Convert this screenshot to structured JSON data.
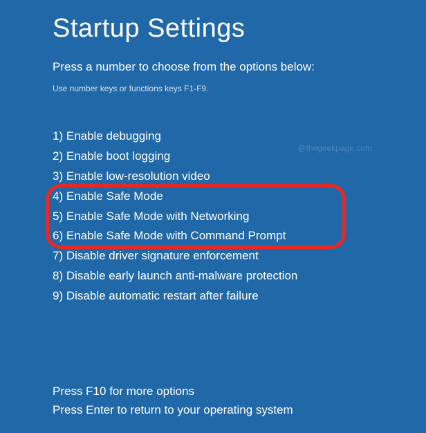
{
  "title": "Startup Settings",
  "instruction": "Press a number to choose from the options below:",
  "hint": "Use number keys or functions keys F1-F9.",
  "watermark": "@thegeekpage.com",
  "options": [
    {
      "num": "1",
      "label": "Enable debugging"
    },
    {
      "num": "2",
      "label": "Enable boot logging"
    },
    {
      "num": "3",
      "label": "Enable low-resolution video"
    },
    {
      "num": "4",
      "label": "Enable Safe Mode"
    },
    {
      "num": "5",
      "label": "Enable Safe Mode with Networking"
    },
    {
      "num": "6",
      "label": "Enable Safe Mode with Command Prompt"
    },
    {
      "num": "7",
      "label": "Disable driver signature enforcement"
    },
    {
      "num": "8",
      "label": "Disable early launch anti-malware protection"
    },
    {
      "num": "9",
      "label": "Disable automatic restart after failure"
    }
  ],
  "footer": {
    "more": "Press F10 for more options",
    "return": "Press Enter to return to your operating system"
  }
}
